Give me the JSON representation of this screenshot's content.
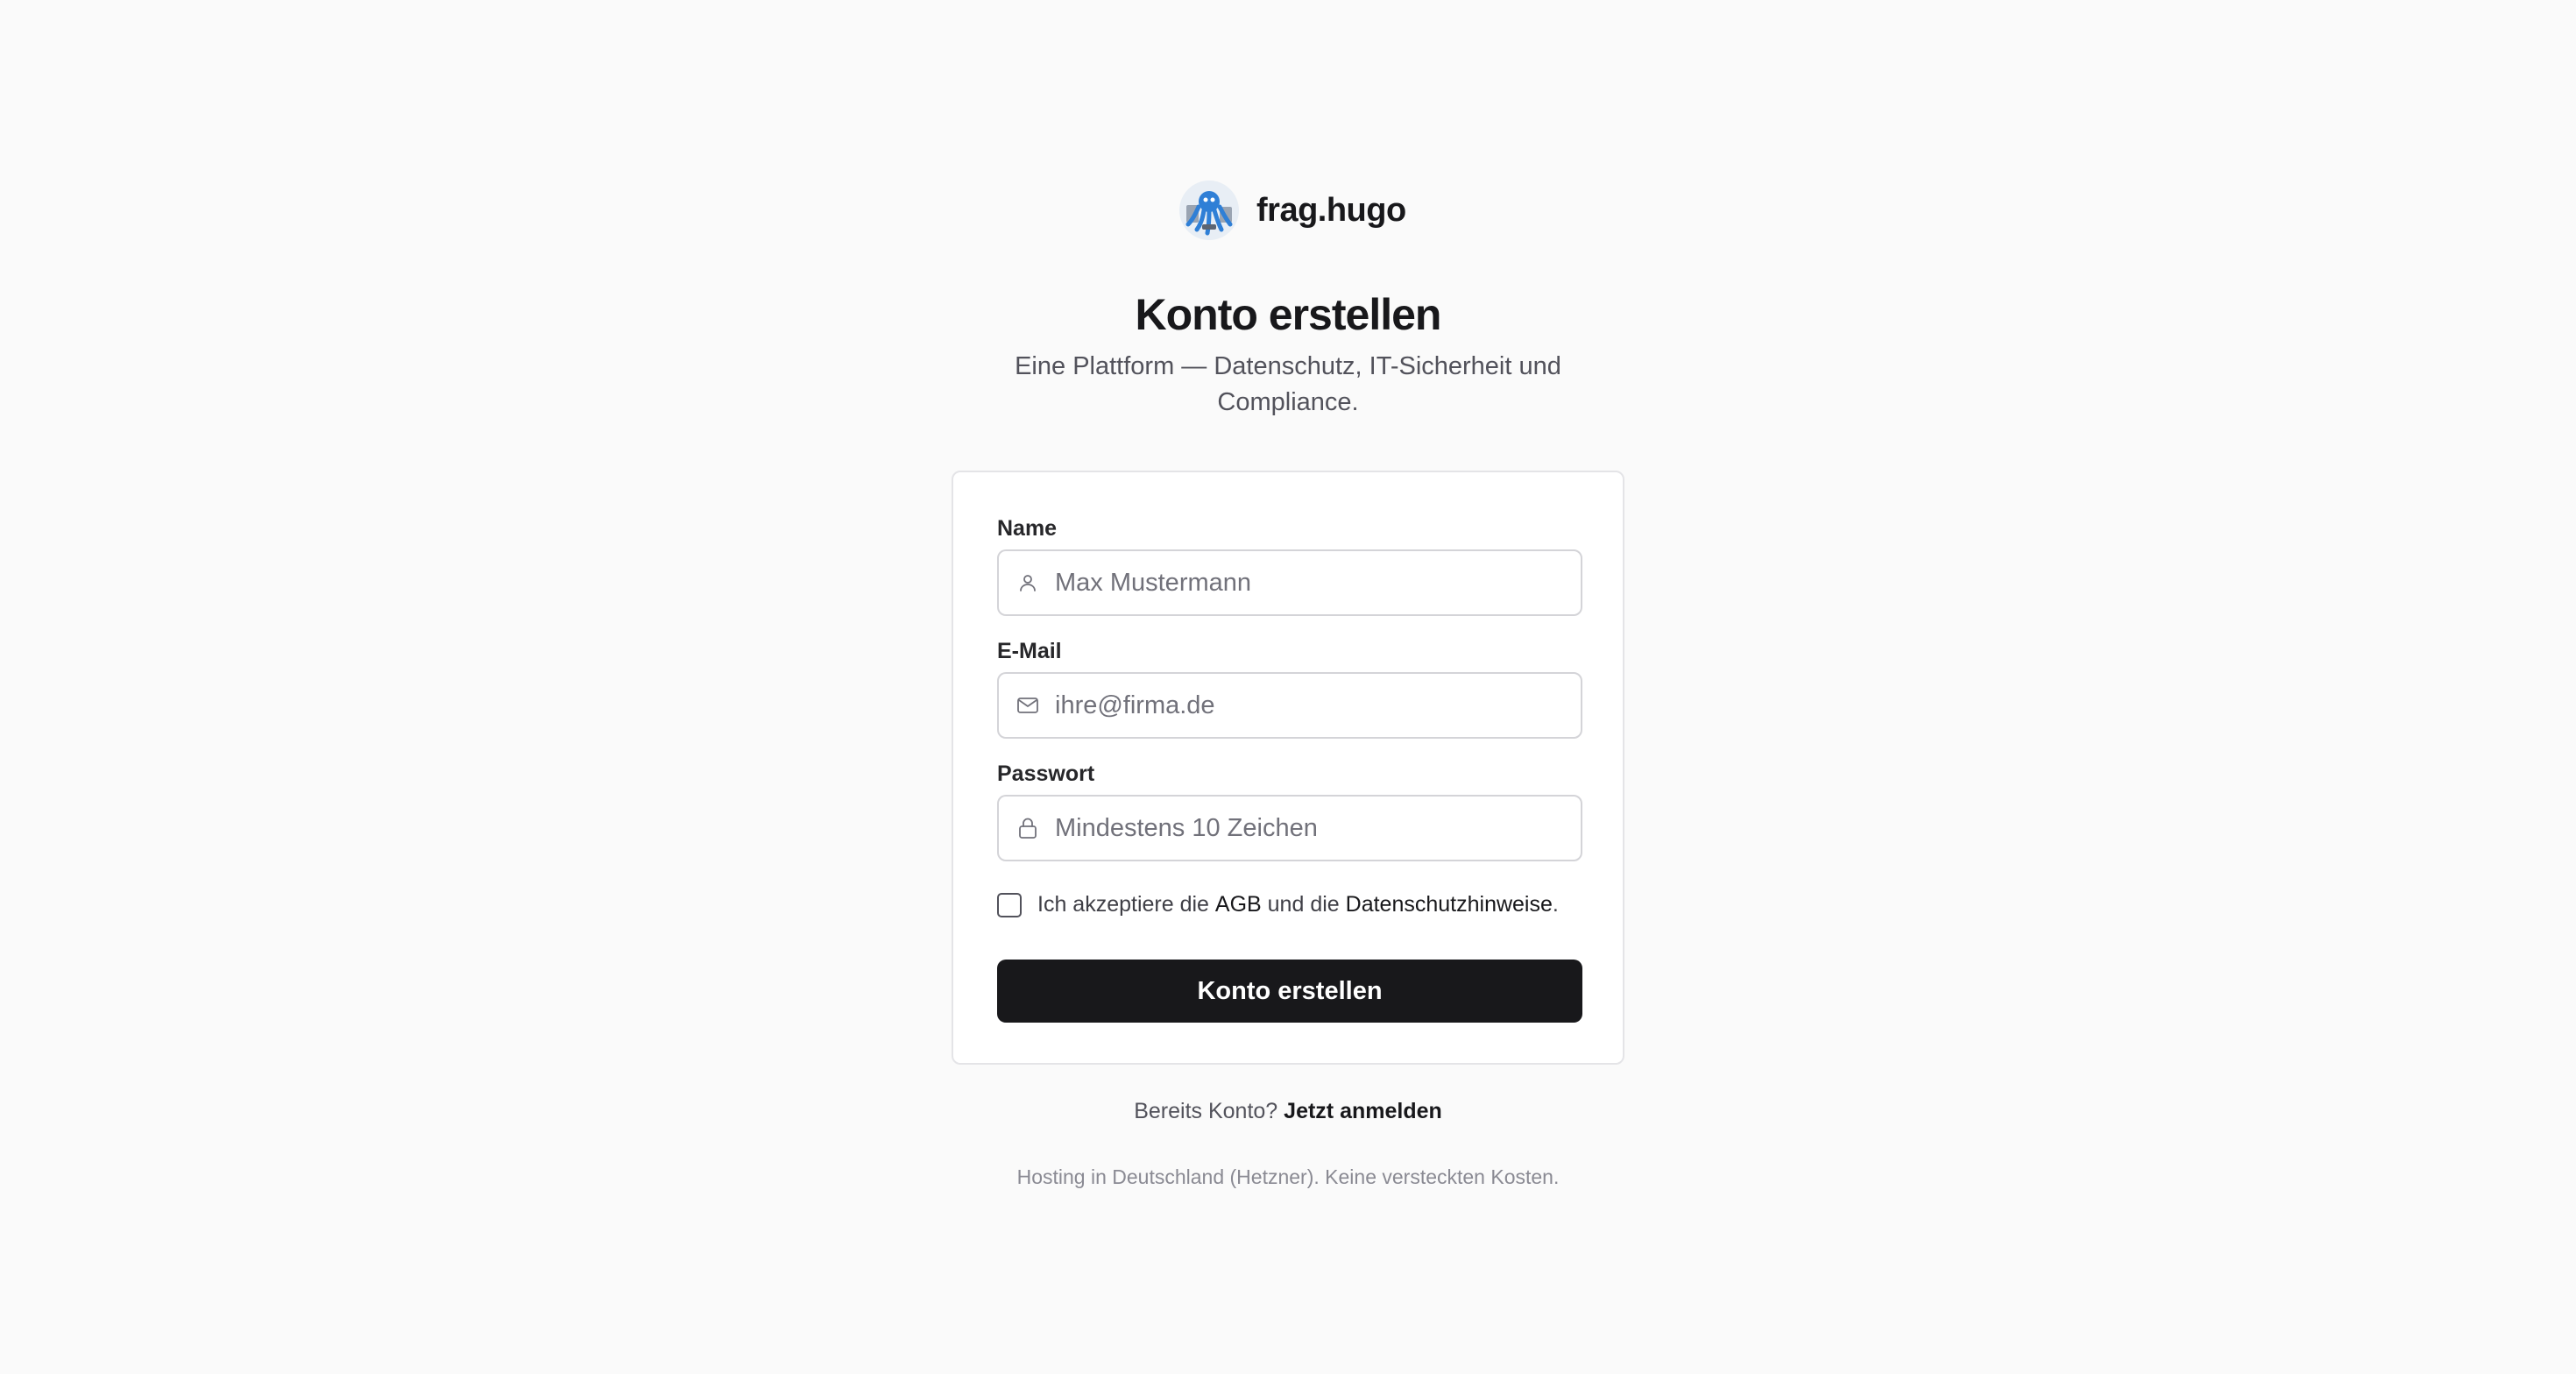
{
  "brand": {
    "name": "frag.hugo",
    "logo_icon": "octopus-mascot-icon"
  },
  "header": {
    "title": "Konto erstellen",
    "subtitle": "Eine Plattform — Datenschutz, IT-Sicherheit und Compliance."
  },
  "form": {
    "name": {
      "label": "Name",
      "placeholder": "Max Mustermann",
      "value": "",
      "icon": "user-icon"
    },
    "email": {
      "label": "E-Mail",
      "placeholder": "ihre@firma.de",
      "value": "",
      "icon": "mail-icon"
    },
    "password": {
      "label": "Passwort",
      "placeholder": "Mindestens 10 Zeichen",
      "value": "",
      "icon": "lock-icon"
    },
    "terms": {
      "checked": false,
      "text_before": "Ich akzeptiere die",
      "agb_link": "AGB",
      "text_middle": "und die",
      "privacy_link": "Datenschutzhinweise",
      "text_after": "."
    },
    "submit_label": "Konto erstellen"
  },
  "login": {
    "prompt": "Bereits Konto?",
    "link": "Jetzt anmelden"
  },
  "footer": {
    "note": "Hosting in Deutschland (Hetzner). Keine versteckten Kosten."
  },
  "colors": {
    "background": "#fafafa",
    "primary_button": "#18181b",
    "border": "#d4d4d8",
    "muted_text": "#52525b",
    "logo_blue": "#2f7fd6"
  }
}
